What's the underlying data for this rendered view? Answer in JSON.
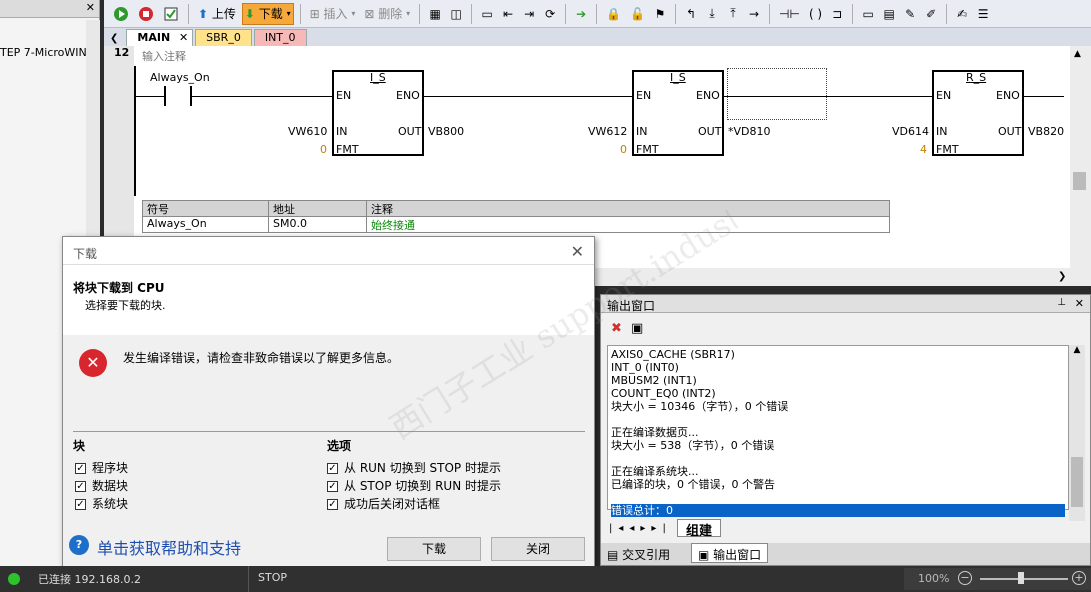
{
  "left_tree": {
    "close_glyph": "✕",
    "project": "TEP 7-MicroWIN"
  },
  "toolbar": {
    "upload": "上传",
    "download": "下载",
    "insert": "插入",
    "delete": "删除"
  },
  "tabs": [
    {
      "label": "MAIN",
      "close": "✕"
    },
    {
      "label": "SBR_0"
    },
    {
      "label": "INT_0"
    }
  ],
  "ladder": {
    "rung_number": "12",
    "comment_placeholder": "输入注释",
    "contact": "Always_On",
    "blocks": [
      {
        "name": "I_S",
        "en": "EN",
        "eno": "ENO",
        "in_label": "IN",
        "out_label": "OUT",
        "fmt_label": "FMT",
        "in_val": "VW610",
        "out_val": "VB800",
        "fmt_val": "0"
      },
      {
        "name": "I_S",
        "en": "EN",
        "eno": "ENO",
        "in_label": "IN",
        "out_label": "OUT",
        "fmt_label": "FMT",
        "in_val": "VW612",
        "out_val": "*VD810",
        "fmt_val": "0"
      },
      {
        "name": "R_S",
        "en": "EN",
        "eno": "ENO",
        "in_label": "IN",
        "out_label": "OUT",
        "fmt_label": "FMT",
        "in_val": "VD614",
        "out_val": "VB820",
        "fmt_val": "4"
      }
    ],
    "symbol_table": {
      "headers": [
        "符号",
        "地址",
        "注释"
      ],
      "row": [
        "Always_On",
        "SM0.0",
        "始终接通"
      ]
    }
  },
  "dialog": {
    "title": "下载",
    "heading": "将块下载到 CPU",
    "subheading": "选择要下载的块.",
    "error_msg": "发生编译错误，请检查非致命错误以了解更多信息。",
    "blocks_title": "块",
    "blocks": [
      "程序块",
      "数据块",
      "系统块"
    ],
    "options_title": "选项",
    "options": [
      "从 RUN 切换到 STOP 时提示",
      "从 STOP 切换到 RUN 时提示",
      "成功后关闭对话框"
    ],
    "help_link": "单击获取帮助和支持",
    "download_btn": "下载",
    "close_btn": "关闭"
  },
  "output_window": {
    "title": "输出窗口",
    "lines": [
      "AXIS0_CACHE (SBR17)",
      "INT_0 (INT0)",
      "MBUSM2 (INT1)",
      "COUNT_EQ0 (INT2)",
      "块大小 = 10346（字节），0 个错误",
      "",
      "正在编译数据页...",
      "块大小 = 538（字节），0 个错误",
      "",
      "正在编译系统块...",
      "已编译的块，0 个错误，0 个警告",
      ""
    ],
    "highlight_line": "错误总计：0",
    "tab_active": "组建",
    "bottom_tabs": [
      "交叉引用",
      "输出窗口"
    ]
  },
  "status": {
    "connection": "已连接 192.168.0.2",
    "mode": "STOP",
    "zoom": "100%"
  },
  "watermark": "西门子工业 support.industry.siemens.com/cs",
  "colors": {
    "highlight": "#0a64c8",
    "download_hl": "#f6a93a",
    "comment_green": "#0a8a0a",
    "error_red": "#d8262e"
  }
}
